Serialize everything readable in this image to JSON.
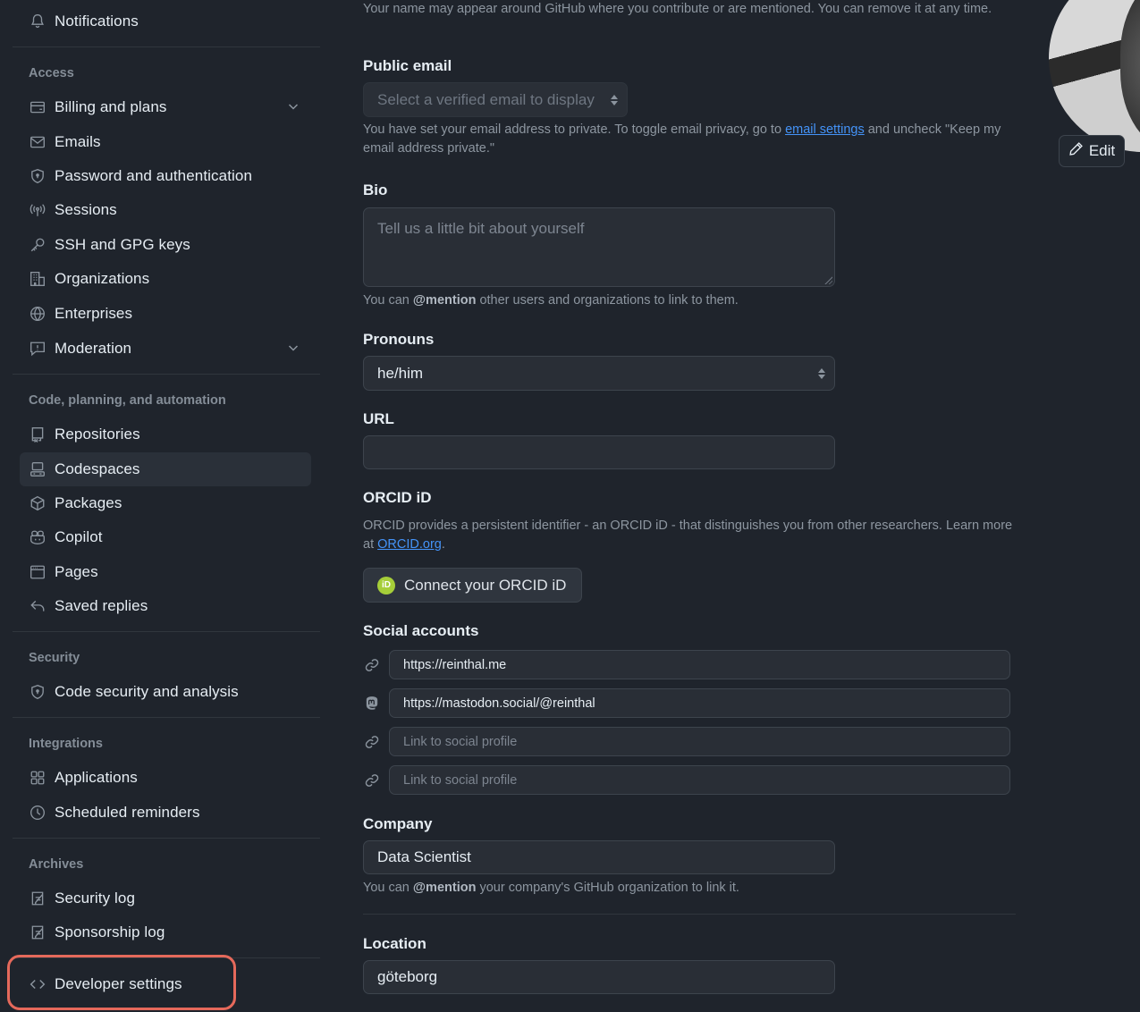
{
  "sidebar": {
    "top_item": {
      "label": "Notifications",
      "icon": "bell-icon"
    },
    "sections": [
      {
        "title": "Access"
      },
      {
        "title": "Code, planning, and automation"
      },
      {
        "title": "Security"
      },
      {
        "title": "Integrations"
      },
      {
        "title": "Archives"
      }
    ],
    "items": [
      {
        "label": "Billing and plans",
        "icon": "credit-card-icon",
        "expandable": true
      },
      {
        "label": "Emails",
        "icon": "mail-icon"
      },
      {
        "label": "Password and authentication",
        "icon": "shield-lock-icon"
      },
      {
        "label": "Sessions",
        "icon": "broadcast-icon"
      },
      {
        "label": "SSH and GPG keys",
        "icon": "key-icon"
      },
      {
        "label": "Organizations",
        "icon": "organization-icon"
      },
      {
        "label": "Enterprises",
        "icon": "globe-icon"
      },
      {
        "label": "Moderation",
        "icon": "report-icon",
        "expandable": true
      },
      {
        "label": "Repositories",
        "icon": "repo-icon"
      },
      {
        "label": "Codespaces",
        "icon": "codespaces-icon",
        "active": true
      },
      {
        "label": "Packages",
        "icon": "package-icon"
      },
      {
        "label": "Copilot",
        "icon": "copilot-icon"
      },
      {
        "label": "Pages",
        "icon": "browser-icon"
      },
      {
        "label": "Saved replies",
        "icon": "reply-icon"
      },
      {
        "label": "Code security and analysis",
        "icon": "shield-lock-icon"
      },
      {
        "label": "Applications",
        "icon": "apps-icon"
      },
      {
        "label": "Scheduled reminders",
        "icon": "clock-icon"
      },
      {
        "label": "Security log",
        "icon": "log-icon"
      },
      {
        "label": "Sponsorship log",
        "icon": "log-icon"
      }
    ],
    "developer_settings": {
      "label": "Developer settings",
      "icon": "code-icon",
      "highlighted": true
    }
  },
  "profile": {
    "name_help": "Your name may appear around GitHub where you contribute or are mentioned. You can remove it at any time.",
    "public_email": {
      "label": "Public email",
      "placeholder": "Select a verified email to display",
      "help_before": "You have set your email address to private. To toggle email privacy, go to ",
      "help_link": "email settings",
      "help_after": " and uncheck \"Keep my email address private.\""
    },
    "bio": {
      "label": "Bio",
      "placeholder": "Tell us a little bit about yourself",
      "value": "",
      "help_before": "You can ",
      "help_bold": "@mention",
      "help_after": " other users and organizations to link to them."
    },
    "pronouns": {
      "label": "Pronouns",
      "value": "he/him"
    },
    "url": {
      "label": "URL",
      "value": ""
    },
    "orcid": {
      "label": "ORCID iD",
      "help_before": "ORCID provides a persistent identifier - an ORCID iD - that distinguishes you from other researchers. Learn more at ",
      "help_link": "ORCID.org",
      "help_after": ".",
      "button": "Connect your ORCID iD",
      "logo_text": "iD"
    },
    "social": {
      "label": "Social accounts",
      "accounts": [
        {
          "icon": "link-icon",
          "value": "https://reinthal.me",
          "placeholder": "Link to social profile"
        },
        {
          "icon": "mastodon-icon",
          "value": "https://mastodon.social/@reinthal",
          "placeholder": "Link to social profile"
        },
        {
          "icon": "link-icon",
          "value": "",
          "placeholder": "Link to social profile"
        },
        {
          "icon": "link-icon",
          "value": "",
          "placeholder": "Link to social profile"
        }
      ]
    },
    "company": {
      "label": "Company",
      "value": "Data Scientist",
      "help_before": "You can ",
      "help_bold": "@mention",
      "help_after": " your company's GitHub organization to link it."
    },
    "location": {
      "label": "Location",
      "value": "göteborg"
    },
    "avatar": {
      "edit_label": "Edit"
    }
  },
  "colors": {
    "background": "#1f242c",
    "link": "#4493f8",
    "highlight": "#e5695b",
    "orcid": "#a6ce39"
  }
}
